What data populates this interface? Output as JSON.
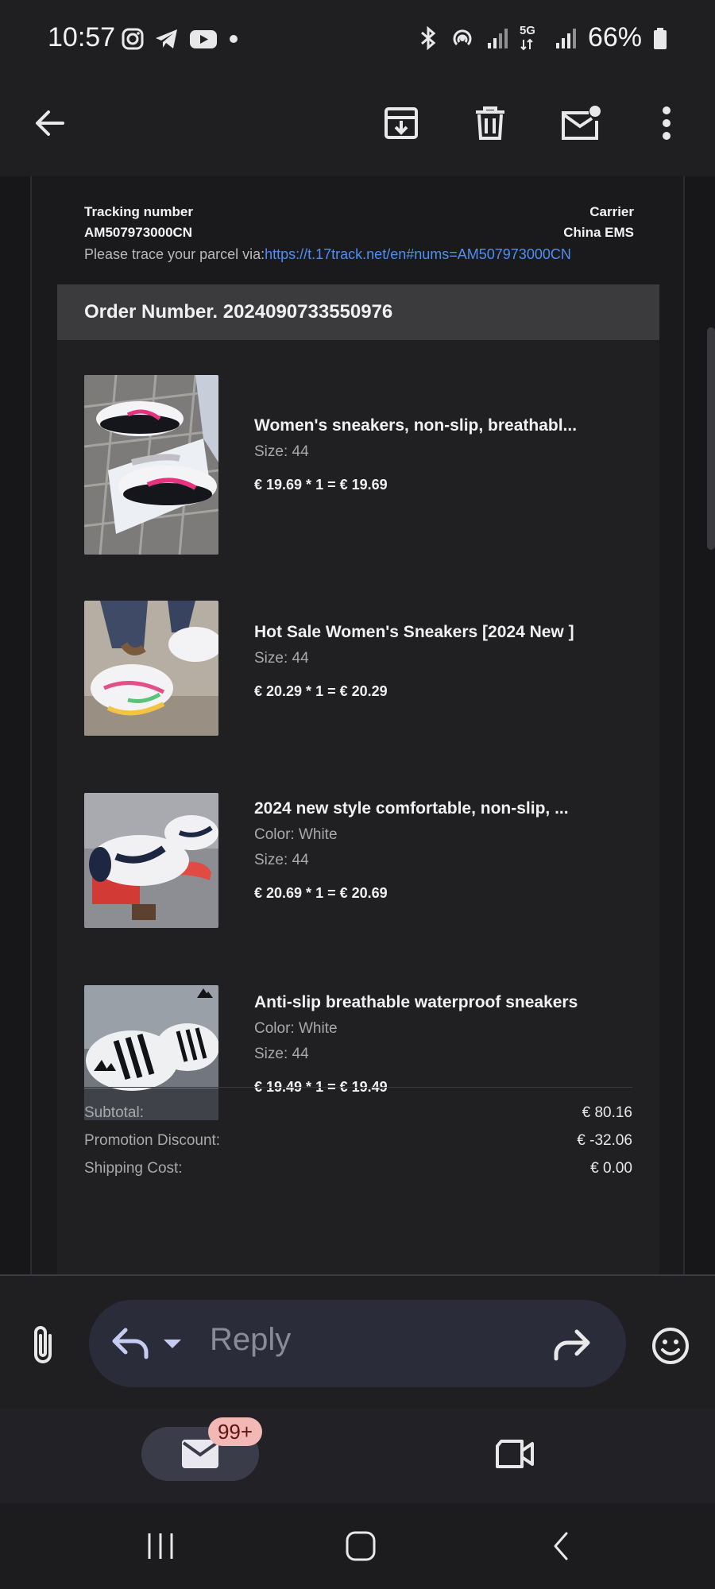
{
  "status_bar": {
    "time": "10:57",
    "network": "5G",
    "battery": "66%",
    "left_icons": [
      "instagram-icon",
      "telegram-icon",
      "youtube-icon",
      "dot-icon"
    ],
    "right_icons": [
      "bluetooth-icon",
      "hotspot-icon",
      "signal-icon",
      "signal-5g-icon",
      "battery-icon"
    ]
  },
  "toolbar": {
    "icons": [
      "back-arrow-icon",
      "archive-icon",
      "trash-icon",
      "mark-unread-icon",
      "more-vert-icon"
    ]
  },
  "tracking": {
    "number_label": "Tracking number",
    "number": "AM507973000CN",
    "carrier_label": "Carrier",
    "carrier": "China EMS",
    "trace_prefix": "Please trace your parcel via:",
    "trace_link": "https://t.17track.net/en#nums=AM507973000CN"
  },
  "order": {
    "header": "Order Number. 2024090733550976",
    "items": [
      {
        "title": "Women's sneakers, non-slip, breathabl...",
        "size": "Size: 44",
        "price": "€ 19.69 * 1 = € 19.69"
      },
      {
        "title": "Hot Sale Women's Sneakers [2024 New ]",
        "size": "Size: 44",
        "price": "€ 20.29 * 1 = € 20.29"
      },
      {
        "title": "2024 new style comfortable, non-slip, ...",
        "color": "Color: White",
        "size": "Size: 44",
        "price": "€ 20.69 * 1 = € 20.69"
      },
      {
        "title": "Anti-slip breathable waterproof sneakers",
        "color": "Color: White",
        "size": "Size: 44",
        "price": "€ 19.49 * 1 = € 19.49"
      }
    ],
    "totals": [
      {
        "label": "Subtotal:",
        "value": "€ 80.16"
      },
      {
        "label": "Promotion Discount:",
        "value": "€ -32.06"
      },
      {
        "label": "Shipping Cost:",
        "value": "€ 0.00"
      }
    ]
  },
  "reply_bar": {
    "reply_label": "Reply",
    "icons": [
      "attach-icon",
      "reply-icon",
      "dropdown-icon",
      "forward-icon",
      "emoji-icon"
    ]
  },
  "bottom_nav": {
    "mail_badge": "99+",
    "icons": [
      "mail-icon",
      "video-meet-icon"
    ]
  },
  "system_nav": {
    "icons": [
      "recents-icon",
      "home-icon",
      "back-icon"
    ]
  },
  "colors": {
    "background": "#1f1e22",
    "link": "#4f8ef3",
    "order_header": "#3b3b3e",
    "badge": "#f2b8b5"
  }
}
